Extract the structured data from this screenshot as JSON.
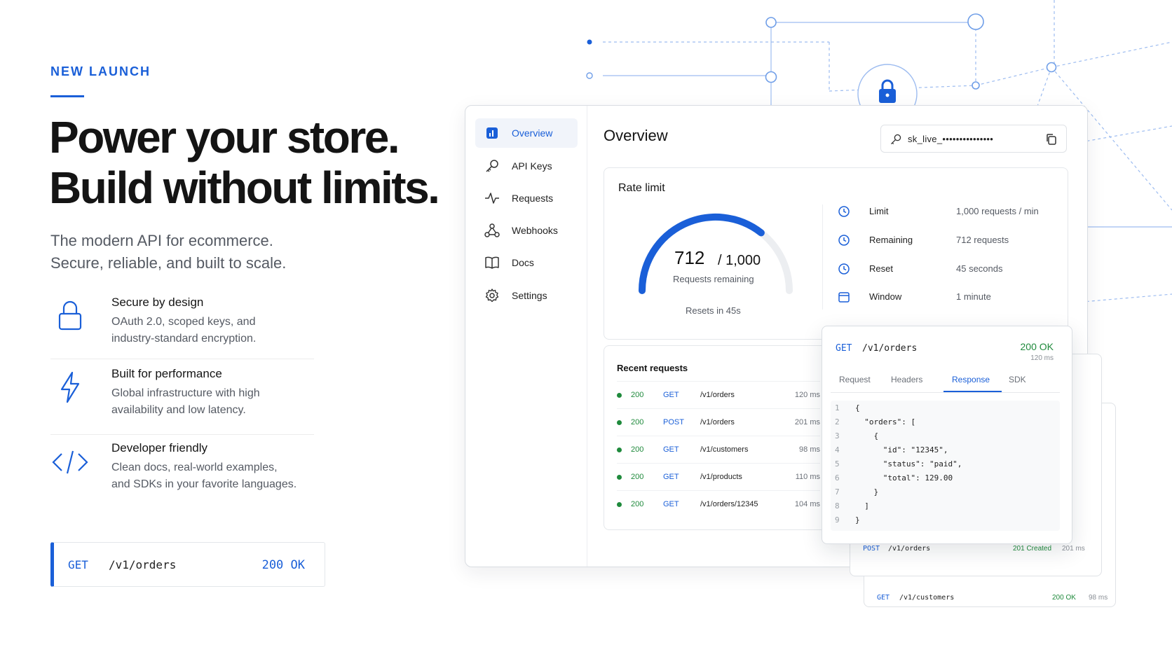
{
  "hero": {
    "eyebrow": "NEW LAUNCH",
    "headline_line1": "Power your store.",
    "headline_line2": "Build without limits.",
    "sub_line1": "The modern API for ecommerce.",
    "sub_line2": "Secure, reliable, and built to scale."
  },
  "features": [
    {
      "icon": "lock-icon",
      "title": "Secure by design",
      "desc_line1": "OAuth 2.0, scoped keys, and",
      "desc_line2": "industry-standard encryption."
    },
    {
      "icon": "lightning-icon",
      "title": "Built for performance",
      "desc_line1": "Global infrastructure with high",
      "desc_line2": "availability and low latency."
    },
    {
      "icon": "code-icon",
      "title": "Developer friendly",
      "desc_line1": "Clean docs, real-world examples,",
      "desc_line2": "and SDKs in your favorite languages."
    }
  ],
  "endpoint": {
    "method": "GET",
    "path": "/v1/orders",
    "status": "200 OK"
  },
  "sidebar": {
    "items": [
      {
        "label": "Overview",
        "icon": "dashboard-icon",
        "active": true
      },
      {
        "label": "API Keys",
        "icon": "key-icon"
      },
      {
        "label": "Requests",
        "icon": "activity-icon"
      },
      {
        "label": "Webhooks",
        "icon": "webhook-icon"
      },
      {
        "label": "Docs",
        "icon": "book-icon"
      },
      {
        "label": "Settings",
        "icon": "gear-icon"
      }
    ]
  },
  "overview": {
    "title": "Overview",
    "api_key": "sk_live_•••••••••••••••"
  },
  "rate_limit": {
    "title": "Rate limit",
    "used_value": "712",
    "total_text": "/ 1,000",
    "caption": "Requests remaining",
    "reset_text": "Resets in 45s",
    "remaining_fraction": 0.712,
    "stats": [
      {
        "label": "Limit",
        "value": "1,000 requests / min",
        "icon": "clock-icon"
      },
      {
        "label": "Remaining",
        "value": "712 requests",
        "icon": "clock-icon"
      },
      {
        "label": "Reset",
        "value": "45 seconds",
        "icon": "clock-icon"
      },
      {
        "label": "Window",
        "value": "1 minute",
        "icon": "calendar-icon"
      }
    ]
  },
  "recent": {
    "title": "Recent requests",
    "rows": [
      {
        "code": "200",
        "method": "GET",
        "path": "/v1/orders",
        "ms": "120 ms"
      },
      {
        "code": "200",
        "method": "POST",
        "path": "/v1/orders",
        "ms": "201 ms"
      },
      {
        "code": "200",
        "method": "GET",
        "path": "/v1/customers",
        "ms": "98 ms"
      },
      {
        "code": "200",
        "method": "GET",
        "path": "/v1/products",
        "ms": "110 ms"
      },
      {
        "code": "200",
        "method": "GET",
        "path": "/v1/orders/12345",
        "ms": "104 ms"
      }
    ]
  },
  "response": {
    "method": "GET",
    "path": "/v1/orders",
    "status": "200 OK",
    "ms": "120 ms",
    "tabs": [
      "Request",
      "Headers",
      "Response",
      "SDK"
    ],
    "active_tab": "Response",
    "lines": [
      "{",
      "  \"orders\": [",
      "    {",
      "      \"id\": \"12345\",",
      "      \"status\": \"paid\",",
      "      \"total\": 129.00",
      "    }",
      "  ]",
      "}"
    ]
  },
  "stacked": [
    {
      "method": "POST",
      "path": "/v1/orders",
      "status": "201 Created",
      "ms": "201 ms"
    },
    {
      "method": "GET",
      "path": "/v1/customers",
      "status": "200 OK",
      "ms": "98 ms"
    }
  ],
  "colors": {
    "accent": "#1a5fd8",
    "success": "#1f8a3c",
    "text": "#141414",
    "muted": "#555a63"
  }
}
